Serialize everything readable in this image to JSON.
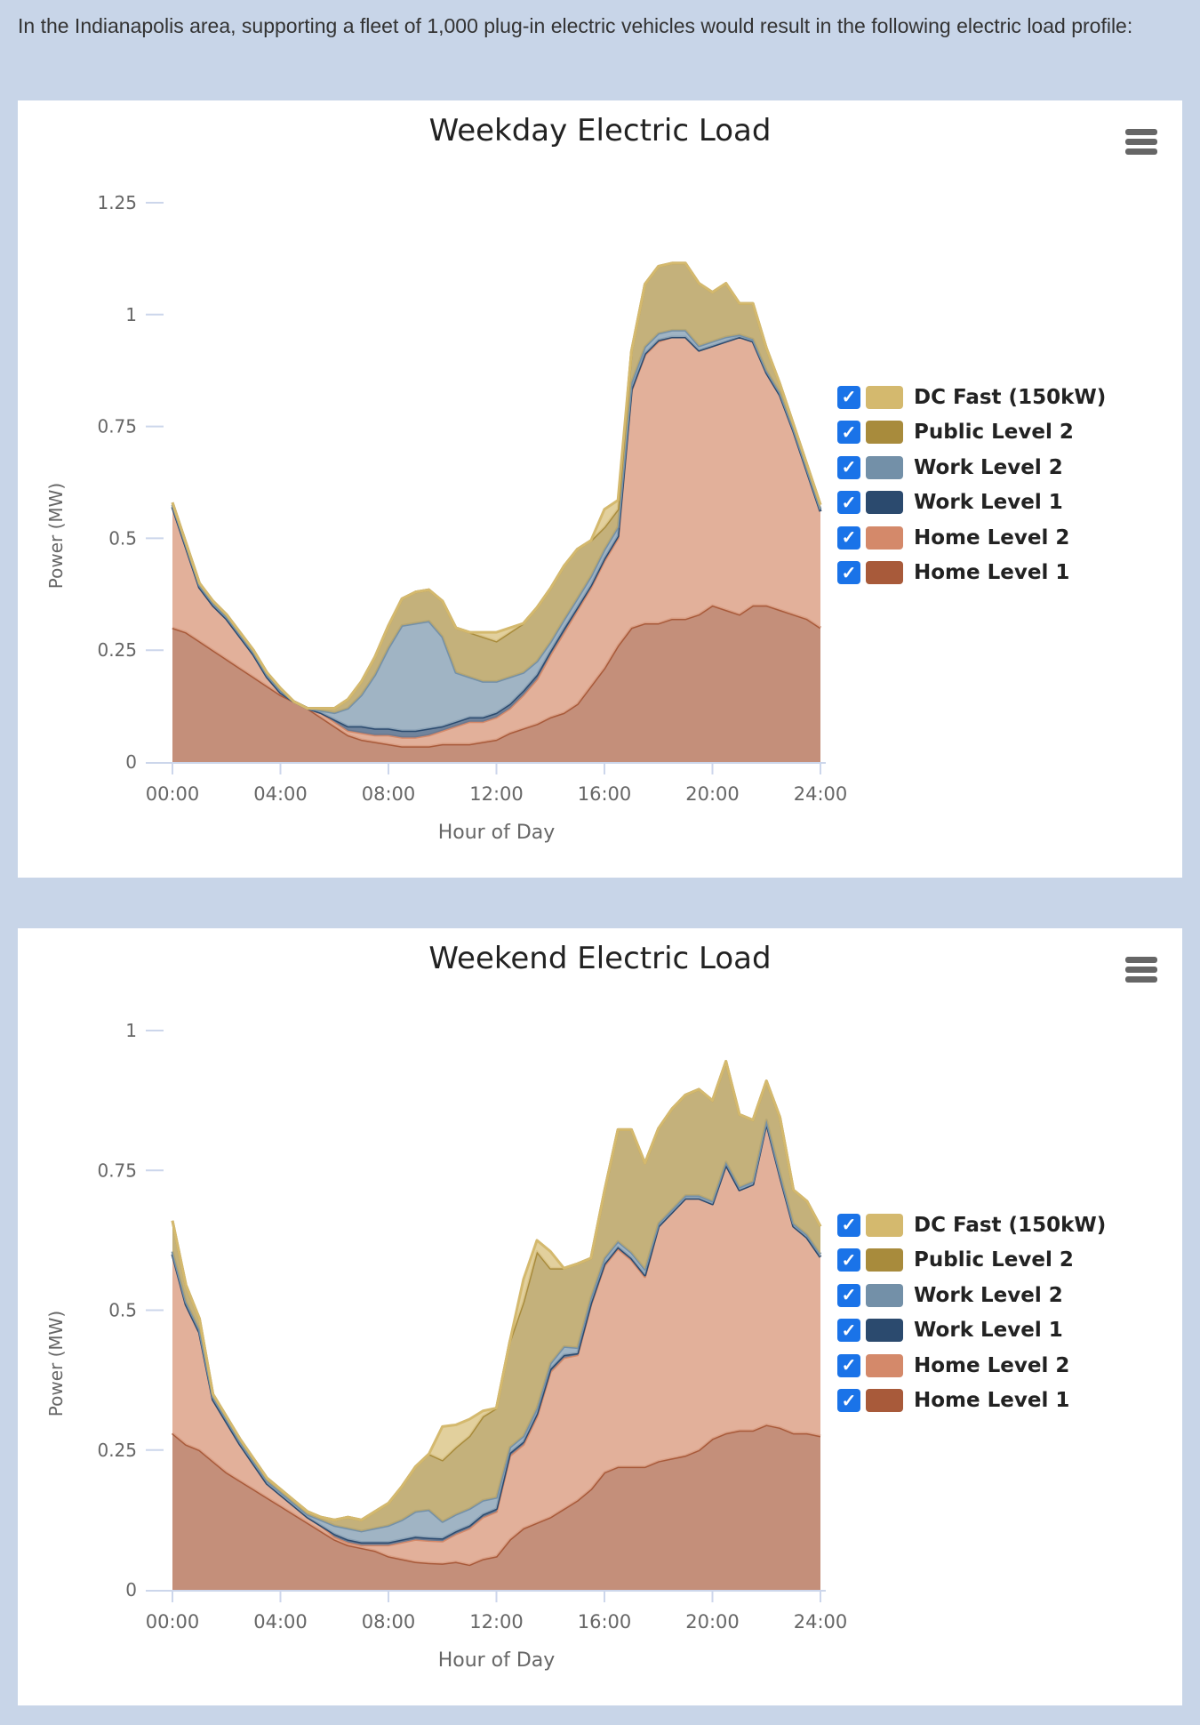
{
  "intro_text": "In the Indianapolis area, supporting a fleet of 1,000 plug-in electric vehicles would result in the following electric load profile:",
  "menu_icon": "hamburger-menu-icon",
  "checkbox_icon": "checkmark-icon",
  "colors": {
    "dc_fast": "#D4B96E",
    "public_l2": "#A88B3C",
    "work_l2": "#7390A8",
    "work_l1": "#2B4A6E",
    "home_l2": "#D4896A",
    "home_l1": "#A85A3A",
    "axis": "#CCD6EB",
    "tick_text": "#666666",
    "page_bg": "#C8D5E8"
  },
  "legend": [
    {
      "label": "DC Fast (150kW)",
      "key": "dc_fast",
      "checked": true
    },
    {
      "label": "Public Level 2",
      "key": "public_l2",
      "checked": true
    },
    {
      "label": "Work Level 2",
      "key": "work_l2",
      "checked": true
    },
    {
      "label": "Work Level 1",
      "key": "work_l1",
      "checked": true
    },
    {
      "label": "Home Level 2",
      "key": "home_l2",
      "checked": true
    },
    {
      "label": "Home Level 1",
      "key": "home_l1",
      "checked": true
    }
  ],
  "chart_data": [
    {
      "type": "area",
      "stacked": true,
      "title": "Weekday Electric Load",
      "xlabel": "Hour of Day",
      "ylabel": "Power (MW)",
      "xlim": [
        0,
        24
      ],
      "ylim": [
        0,
        1.25
      ],
      "xticks": [
        "00:00",
        "04:00",
        "08:00",
        "12:00",
        "16:00",
        "20:00",
        "24:00"
      ],
      "yticks": [
        "0",
        "0.25",
        "0.5",
        "0.75",
        "1",
        "1.25"
      ],
      "ytick_values": [
        0,
        0.25,
        0.5,
        0.75,
        1,
        1.25
      ],
      "legend_position": "right",
      "grid": false,
      "x_hours": [
        0,
        0.5,
        1,
        1.5,
        2,
        2.5,
        3,
        3.5,
        4,
        4.5,
        5,
        5.5,
        6,
        6.5,
        7,
        7.5,
        8,
        8.5,
        9,
        9.5,
        10,
        10.5,
        11,
        11.5,
        12,
        12.5,
        13,
        13.5,
        14,
        14.5,
        15,
        15.5,
        16,
        16.5,
        17,
        17.5,
        18,
        18.5,
        19,
        19.5,
        20,
        20.5,
        21,
        21.5,
        22,
        22.5,
        23,
        23.5,
        24
      ],
      "series": [
        {
          "name": "Home Level 1",
          "key": "home_l1",
          "values": [
            0.3,
            0.29,
            0.27,
            0.25,
            0.23,
            0.21,
            0.19,
            0.17,
            0.15,
            0.135,
            0.12,
            0.1,
            0.08,
            0.06,
            0.05,
            0.045,
            0.04,
            0.035,
            0.035,
            0.035,
            0.04,
            0.04,
            0.04,
            0.045,
            0.05,
            0.065,
            0.075,
            0.085,
            0.1,
            0.11,
            0.13,
            0.17,
            0.21,
            0.26,
            0.3,
            0.31,
            0.31,
            0.32,
            0.32,
            0.33,
            0.35,
            0.34,
            0.33,
            0.35,
            0.35,
            0.34,
            0.33,
            0.32,
            0.3
          ]
        },
        {
          "name": "Home Level 2",
          "key": "home_l2",
          "values": [
            0.27,
            0.19,
            0.12,
            0.1,
            0.09,
            0.07,
            0.05,
            0.02,
            0.005,
            0,
            0,
            0.01,
            0.01,
            0.01,
            0.015,
            0.015,
            0.02,
            0.02,
            0.02,
            0.025,
            0.03,
            0.04,
            0.05,
            0.045,
            0.05,
            0.055,
            0.075,
            0.1,
            0.14,
            0.18,
            0.21,
            0.22,
            0.24,
            0.24,
            0.53,
            0.6,
            0.63,
            0.63,
            0.63,
            0.59,
            0.58,
            0.6,
            0.62,
            0.59,
            0.52,
            0.48,
            0.41,
            0.33,
            0.26
          ]
        },
        {
          "name": "Work Level 1",
          "key": "work_l1",
          "values": [
            0,
            0,
            0,
            0,
            0,
            0,
            0,
            0,
            0,
            0,
            0,
            0,
            0.005,
            0.01,
            0.015,
            0.015,
            0.015,
            0.015,
            0.015,
            0.015,
            0.01,
            0.01,
            0.01,
            0.01,
            0.01,
            0.01,
            0.01,
            0.01,
            0.008,
            0.008,
            0.006,
            0.005,
            0.005,
            0.005,
            0.003,
            0.003,
            0.003,
            0,
            0,
            0,
            0,
            0,
            0,
            0,
            0,
            0,
            0,
            0,
            0
          ]
        },
        {
          "name": "Work Level 2",
          "key": "work_l2",
          "values": [
            0.005,
            0.005,
            0.005,
            0.005,
            0.005,
            0.005,
            0.005,
            0.005,
            0.005,
            0,
            0,
            0.005,
            0.015,
            0.04,
            0.07,
            0.12,
            0.18,
            0.235,
            0.24,
            0.24,
            0.2,
            0.11,
            0.09,
            0.08,
            0.07,
            0.06,
            0.04,
            0.03,
            0.02,
            0.02,
            0.02,
            0.02,
            0.02,
            0.02,
            0.015,
            0.015,
            0.015,
            0.015,
            0.015,
            0.01,
            0.01,
            0.01,
            0.005,
            0.005,
            0.005,
            0.005,
            0.005,
            0.005,
            0.005
          ]
        },
        {
          "name": "Public Level 2",
          "key": "public_l2",
          "values": [
            0.005,
            0.005,
            0.005,
            0.005,
            0.005,
            0.005,
            0.005,
            0.005,
            0.005,
            0,
            0,
            0.005,
            0.01,
            0.02,
            0.03,
            0.04,
            0.05,
            0.06,
            0.07,
            0.07,
            0.08,
            0.1,
            0.1,
            0.1,
            0.09,
            0.1,
            0.11,
            0.12,
            0.12,
            0.12,
            0.11,
            0.08,
            0.05,
            0.04,
            0.07,
            0.14,
            0.15,
            0.15,
            0.15,
            0.14,
            0.11,
            0.12,
            0.07,
            0.08,
            0.05,
            0.02,
            0.01,
            0.01,
            0.01
          ]
        },
        {
          "name": "DC Fast (150kW)",
          "key": "dc_fast",
          "values": [
            0,
            0,
            0,
            0,
            0,
            0,
            0,
            0,
            0,
            0,
            0,
            0,
            0,
            0,
            0,
            0,
            0,
            0,
            0,
            0,
            0,
            0,
            0,
            0.01,
            0.02,
            0.01,
            0,
            0,
            0,
            0,
            0,
            0,
            0.04,
            0.02,
            0,
            0,
            0,
            0,
            0,
            0,
            0,
            0,
            0,
            0,
            0,
            0,
            0,
            0,
            0
          ]
        }
      ]
    },
    {
      "type": "area",
      "stacked": true,
      "title": "Weekend Electric Load",
      "xlabel": "Hour of Day",
      "ylabel": "Power (MW)",
      "xlim": [
        0,
        24
      ],
      "ylim": [
        0,
        1
      ],
      "xticks": [
        "00:00",
        "04:00",
        "08:00",
        "12:00",
        "16:00",
        "20:00",
        "24:00"
      ],
      "yticks": [
        "0",
        "0.25",
        "0.5",
        "0.75",
        "1"
      ],
      "ytick_values": [
        0,
        0.25,
        0.5,
        0.75,
        1
      ],
      "legend_position": "right",
      "grid": false,
      "x_hours": [
        0,
        0.5,
        1,
        1.5,
        2,
        2.5,
        3,
        3.5,
        4,
        4.5,
        5,
        5.5,
        6,
        6.5,
        7,
        7.5,
        8,
        8.5,
        9,
        9.5,
        10,
        10.5,
        11,
        11.5,
        12,
        12.5,
        13,
        13.5,
        14,
        14.5,
        15,
        15.5,
        16,
        16.5,
        17,
        17.5,
        18,
        18.5,
        19,
        19.5,
        20,
        20.5,
        21,
        21.5,
        22,
        22.5,
        23,
        23.5,
        24
      ],
      "series": [
        {
          "name": "Home Level 1",
          "key": "home_l1",
          "values": [
            0.28,
            0.26,
            0.25,
            0.23,
            0.21,
            0.195,
            0.18,
            0.165,
            0.15,
            0.135,
            0.12,
            0.105,
            0.09,
            0.08,
            0.075,
            0.07,
            0.06,
            0.055,
            0.05,
            0.048,
            0.047,
            0.05,
            0.045,
            0.055,
            0.06,
            0.09,
            0.11,
            0.12,
            0.13,
            0.145,
            0.16,
            0.18,
            0.21,
            0.22,
            0.22,
            0.22,
            0.23,
            0.235,
            0.24,
            0.25,
            0.27,
            0.28,
            0.285,
            0.285,
            0.295,
            0.29,
            0.28,
            0.28,
            0.275
          ]
        },
        {
          "name": "Home Level 2",
          "key": "home_l2",
          "values": [
            0.32,
            0.25,
            0.21,
            0.11,
            0.09,
            0.065,
            0.045,
            0.025,
            0.02,
            0.015,
            0.01,
            0.01,
            0.005,
            0.005,
            0.005,
            0.01,
            0.02,
            0.03,
            0.04,
            0.04,
            0.04,
            0.05,
            0.065,
            0.075,
            0.08,
            0.15,
            0.15,
            0.19,
            0.26,
            0.27,
            0.26,
            0.33,
            0.37,
            0.39,
            0.37,
            0.34,
            0.42,
            0.44,
            0.46,
            0.45,
            0.42,
            0.48,
            0.43,
            0.44,
            0.54,
            0.45,
            0.37,
            0.35,
            0.32
          ]
        },
        {
          "name": "Work Level 1",
          "key": "work_l1",
          "values": [
            0,
            0,
            0,
            0,
            0,
            0,
            0,
            0,
            0,
            0,
            0,
            0,
            0.005,
            0.005,
            0.005,
            0.005,
            0.005,
            0.005,
            0.005,
            0.005,
            0.005,
            0.005,
            0.005,
            0.005,
            0.005,
            0.005,
            0.005,
            0.005,
            0.005,
            0.005,
            0.003,
            0.003,
            0.003,
            0.003,
            0.003,
            0.003,
            0,
            0,
            0,
            0,
            0,
            0,
            0,
            0,
            0,
            0,
            0,
            0,
            0
          ]
        },
        {
          "name": "Work Level 2",
          "key": "work_l2",
          "values": [
            0.005,
            0.005,
            0.005,
            0.005,
            0.005,
            0.005,
            0.005,
            0.005,
            0.005,
            0.005,
            0.005,
            0.01,
            0.015,
            0.02,
            0.02,
            0.025,
            0.03,
            0.035,
            0.045,
            0.05,
            0.03,
            0.03,
            0.03,
            0.025,
            0.02,
            0.01,
            0.01,
            0.01,
            0.01,
            0.015,
            0.01,
            0.01,
            0.01,
            0.01,
            0.01,
            0.01,
            0.005,
            0.005,
            0.005,
            0.005,
            0.005,
            0.005,
            0.005,
            0.005,
            0.005,
            0.005,
            0.005,
            0.005,
            0.005
          ]
        },
        {
          "name": "Public Level 2",
          "key": "public_l2",
          "values": [
            0.055,
            0.03,
            0.02,
            0.005,
            0.005,
            0.005,
            0.005,
            0.005,
            0.005,
            0.005,
            0.005,
            0.005,
            0.01,
            0.02,
            0.02,
            0.03,
            0.04,
            0.06,
            0.08,
            0.1,
            0.11,
            0.12,
            0.13,
            0.15,
            0.16,
            0.19,
            0.24,
            0.28,
            0.17,
            0.14,
            0.15,
            0.07,
            0.12,
            0.2,
            0.22,
            0.19,
            0.17,
            0.18,
            0.18,
            0.19,
            0.18,
            0.18,
            0.13,
            0.11,
            0.07,
            0.1,
            0.06,
            0.06,
            0.05
          ]
        },
        {
          "name": "DC Fast (150kW)",
          "key": "dc_fast",
          "values": [
            0,
            0,
            0,
            0,
            0,
            0,
            0,
            0,
            0,
            0,
            0,
            0,
            0,
            0,
            0,
            0,
            0,
            0,
            0,
            0,
            0.06,
            0.04,
            0.03,
            0.01,
            0,
            0,
            0.04,
            0.02,
            0.03,
            0,
            0,
            0,
            0,
            0,
            0,
            0,
            0,
            0,
            0,
            0,
            0,
            0,
            0,
            0,
            0,
            0,
            0,
            0,
            0
          ]
        }
      ]
    }
  ]
}
